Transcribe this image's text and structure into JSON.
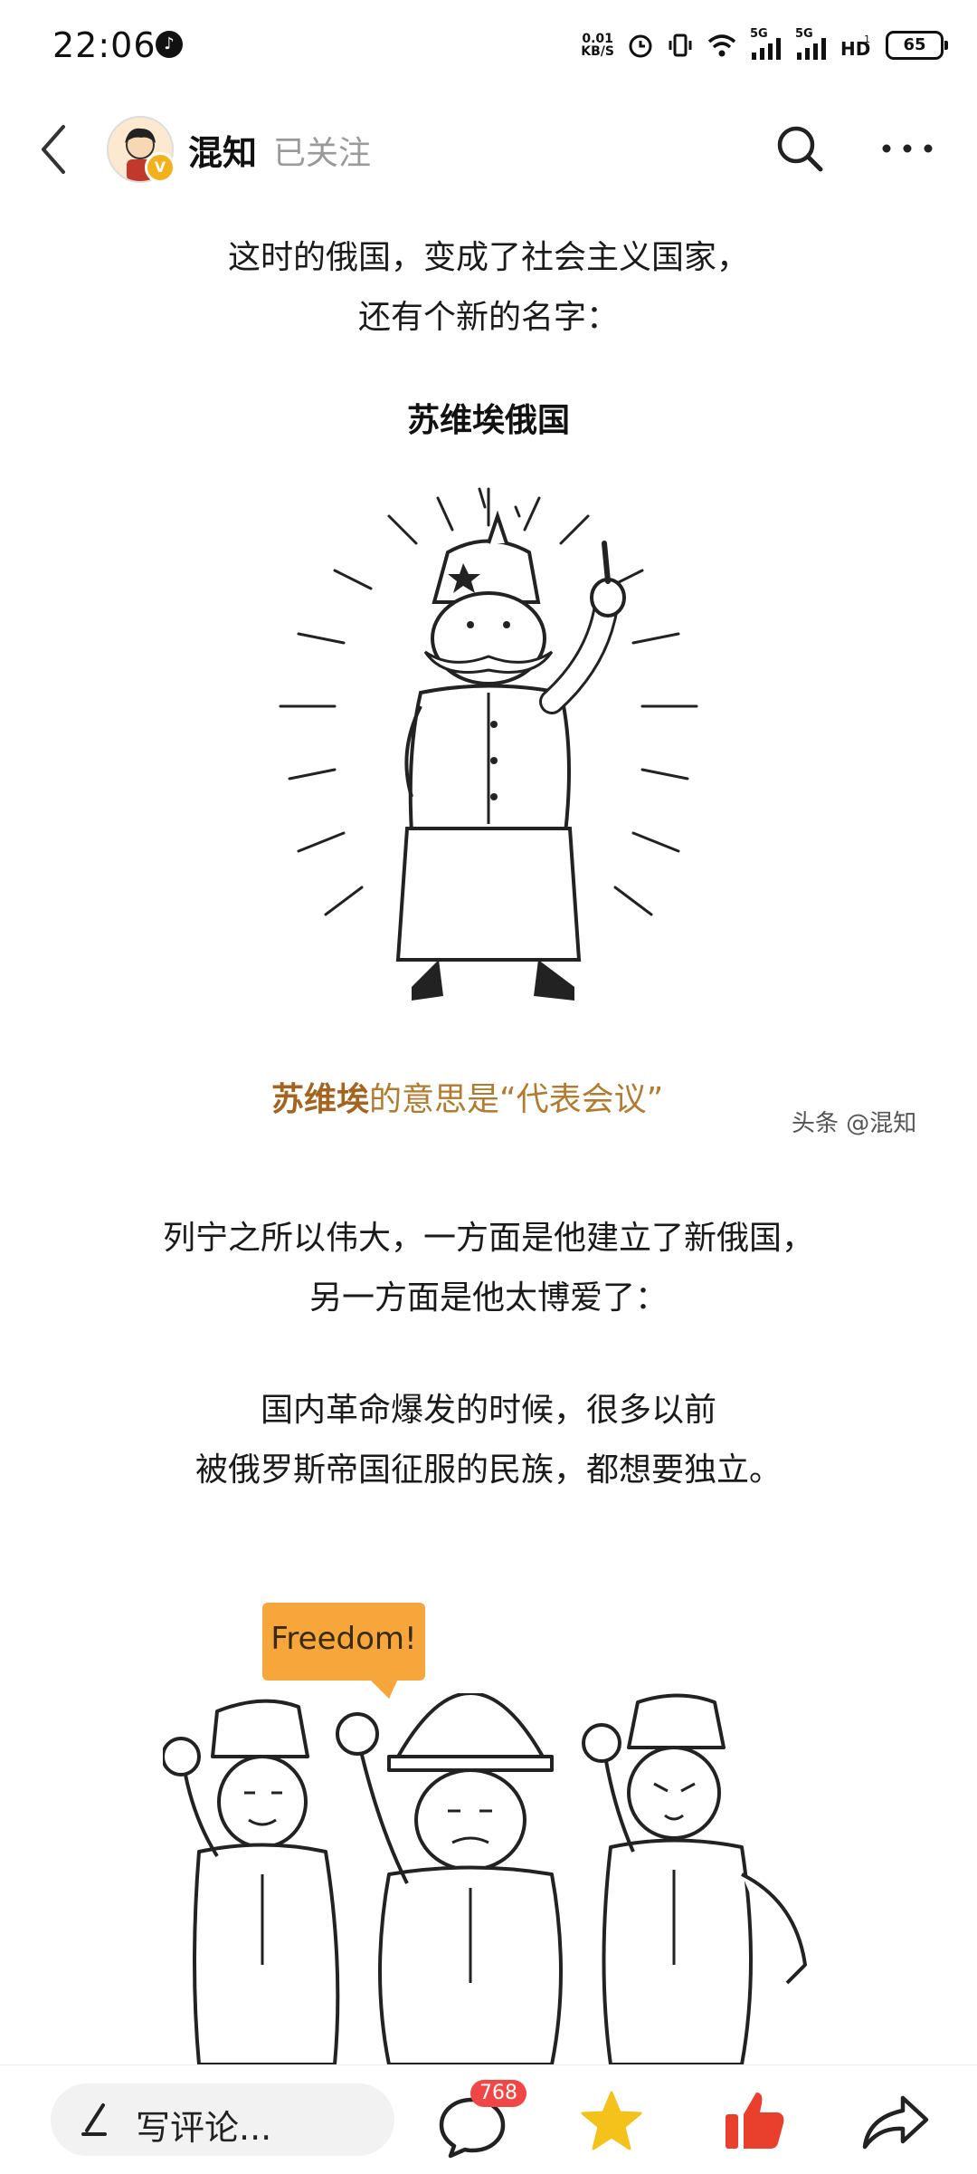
{
  "status_bar": {
    "time": "22:06",
    "net_speed_value": "0.01",
    "net_speed_unit": "KB/S",
    "signal_label_1": "5G",
    "signal_label_2": "5G",
    "battery": "65",
    "notification_icon": "bell-icon",
    "icons": [
      "alarm-icon",
      "vibrate-icon",
      "wifi-icon",
      "signal-icon",
      "signal-icon",
      "hd-icon",
      "battery-icon"
    ]
  },
  "header": {
    "author_name": "混知",
    "follow_status": "已关注",
    "verify_badge": "V",
    "icons": [
      "back-icon",
      "search-icon",
      "more-icon"
    ]
  },
  "article": {
    "paragraph1_line1": "这时的俄国，变成了社会主义国家，",
    "paragraph1_line2": "还有个新的名字：",
    "title": "苏维埃俄国",
    "caption_strong": "苏维埃",
    "caption_rest": "的意思是“代表会议”",
    "watermark": "头条 @混知",
    "paragraph2_line1": "列宁之所以伟大，一方面是他建立了新俄国，",
    "paragraph2_line2": "另一方面是他太博爱了：",
    "paragraph3_line1": "国内革命爆发的时候，很多以前",
    "paragraph3_line2": "被俄罗斯帝国征服的民族，都想要独立。",
    "speech_bubble": "Freedom!"
  },
  "bottom_bar": {
    "comment_placeholder": "写评论...",
    "comment_count": "768",
    "icons": [
      "pen-icon",
      "comment-icon",
      "star-icon",
      "thumbs-up-icon",
      "share-icon"
    ]
  },
  "colors": {
    "accent_orange": "#f6a63a",
    "caption_brown": "#b27b2f",
    "like_red": "#e8402d",
    "star_yellow": "#f5c21b",
    "badge_red": "#f04646"
  }
}
